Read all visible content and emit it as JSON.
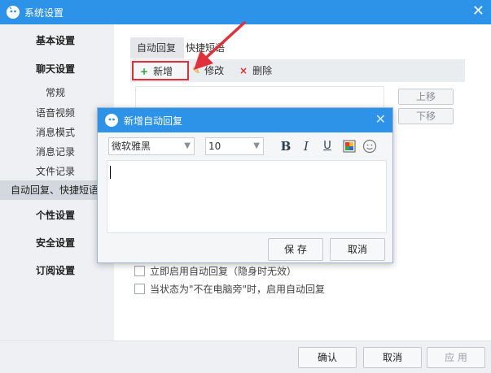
{
  "window": {
    "title": "系统设置"
  },
  "sidebar": {
    "items": [
      {
        "label": "基本设置",
        "kind": "category"
      },
      {
        "label": "聊天设置",
        "kind": "category"
      },
      {
        "label": "常规",
        "kind": "sub"
      },
      {
        "label": "语音视频",
        "kind": "sub"
      },
      {
        "label": "消息模式",
        "kind": "sub"
      },
      {
        "label": "消息记录",
        "kind": "sub"
      },
      {
        "label": "文件记录",
        "kind": "sub"
      },
      {
        "label": "自动回复、快捷短语",
        "kind": "sub",
        "selected": true
      },
      {
        "label": "个性设置",
        "kind": "category"
      },
      {
        "label": "安全设置",
        "kind": "category"
      },
      {
        "label": "订阅设置",
        "kind": "category"
      }
    ]
  },
  "content": {
    "tabs": [
      {
        "label": "自动回复",
        "active": true
      },
      {
        "label": "快捷短语",
        "active": false
      }
    ],
    "toolbar": {
      "add_label": "新增",
      "add_icon": "+",
      "edit_label": "修改",
      "delete_label": "删除",
      "delete_icon": "×"
    },
    "move_up_label": "上移",
    "move_down_label": "下移",
    "options": [
      {
        "label": "立即启用自动回复（隐身时无效）",
        "checked": false
      },
      {
        "label": "当状态为\"不在电脑旁\"时，启用自动回复",
        "checked": false
      }
    ]
  },
  "dialog": {
    "title": "新增自动回复",
    "font_family": "微软雅黑",
    "font_size": "10",
    "bold_label": "B",
    "italic_label": "I",
    "underline_label": "U",
    "save_label": "保 存",
    "cancel_label": "取消"
  },
  "footer": {
    "ok_label": "确认",
    "cancel_label": "取消",
    "apply_label": "应 用"
  },
  "colors": {
    "titlebar": "#2d93e8",
    "highlight": "#e0303a"
  }
}
